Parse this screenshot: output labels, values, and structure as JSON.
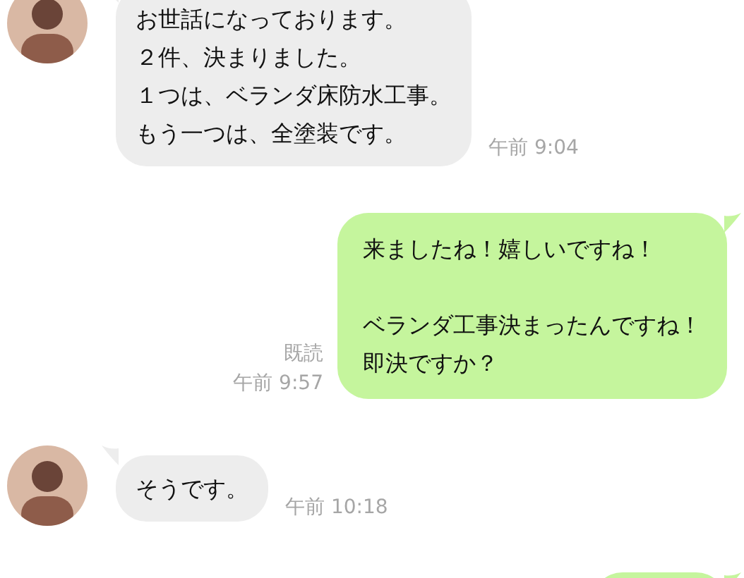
{
  "messages": [
    {
      "kind": "incoming",
      "paragraphs": [
        [
          "お世話になっております。",
          "２件、決まりました。",
          "１つは、ベランダ床防水工事。",
          "もう一つは、全塗装です。"
        ]
      ],
      "time": "午前 9:04"
    },
    {
      "kind": "outgoing",
      "paragraphs": [
        [
          "来ましたね！嬉しいですね！"
        ],
        [
          "ベランダ工事決まったんですね！",
          "即決ですか？"
        ]
      ],
      "read": "既読",
      "time": "午前 9:57"
    },
    {
      "kind": "incoming",
      "paragraphs": [
        [
          "そうです。"
        ]
      ],
      "time": "午前 10:18"
    },
    {
      "kind": "outgoing"
    }
  ]
}
